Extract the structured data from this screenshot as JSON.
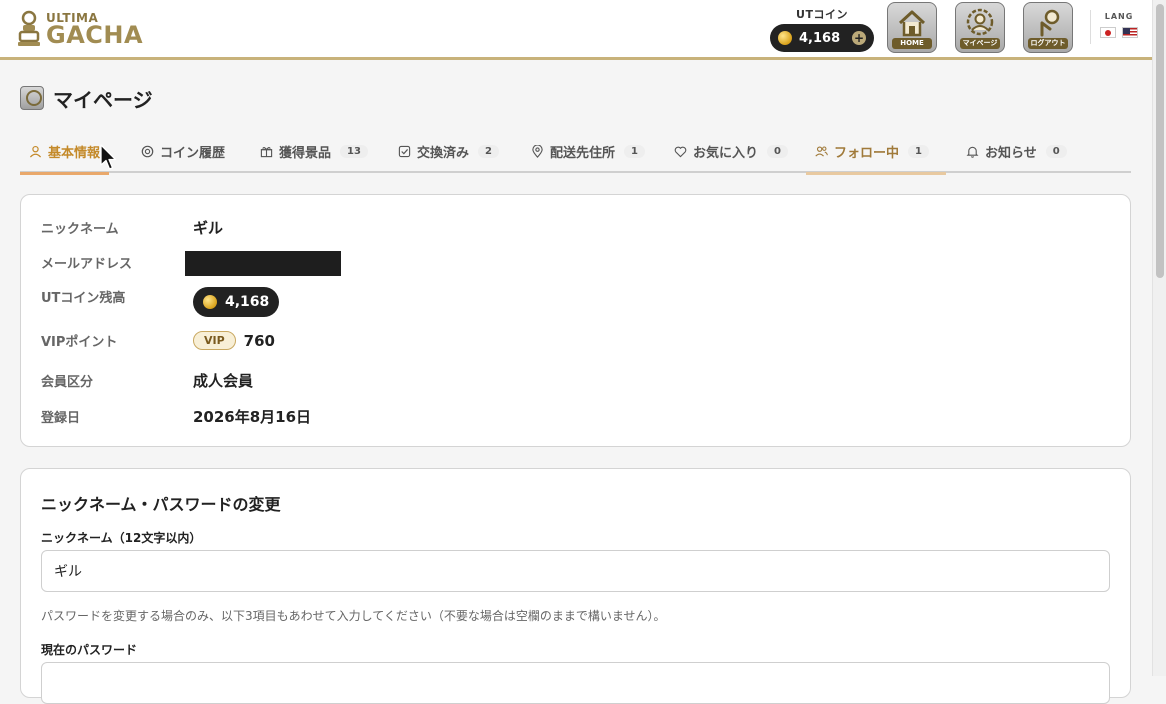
{
  "header": {
    "logo_small": "ULTIMA",
    "logo_big": "GACHA",
    "coin_label": "UTコイン",
    "coin_amount": "4,168",
    "nav": [
      {
        "label": "HOME",
        "icon": "home-icon"
      },
      {
        "label": "マイページ",
        "icon": "mypage-icon"
      },
      {
        "label": "ログアウト",
        "icon": "logout-icon"
      }
    ],
    "lang_label": "LANG"
  },
  "page": {
    "title": "マイページ"
  },
  "tabs": [
    {
      "label": "基本情報",
      "icon": "user-icon",
      "count": ""
    },
    {
      "label": "コイン履歴",
      "icon": "coin-icon",
      "count": ""
    },
    {
      "label": "獲得景品",
      "icon": "gift-icon",
      "count": "13"
    },
    {
      "label": "交換済み",
      "icon": "check-icon",
      "count": "2"
    },
    {
      "label": "配送先住所",
      "icon": "pin-icon",
      "count": "1"
    },
    {
      "label": "お気に入り",
      "icon": "heart-icon",
      "count": "0"
    },
    {
      "label": "フォロー中",
      "icon": "users-icon",
      "count": "1"
    },
    {
      "label": "お知らせ",
      "icon": "bell-icon",
      "count": "0"
    }
  ],
  "profile": {
    "nickname_label": "ニックネーム",
    "nickname": "ギル",
    "email_label": "メールアドレス",
    "balance_label": "UTコイン残高",
    "balance": "4,168",
    "vip_label": "VIPポイント",
    "vip_badge": "VIP",
    "vip_points": "760",
    "member_type_label": "会員区分",
    "member_type": "成人会員",
    "registered_label": "登録日",
    "registered": "2026年8月16日"
  },
  "form": {
    "title": "ニックネーム・パスワードの変更",
    "nickname_field_label": "ニックネーム（12文字以内）",
    "nickname_value": "ギル",
    "hint": "パスワードを変更する場合のみ、以下3項目もあわせて入力してください（不要な場合は空欄のままで構いません）。",
    "current_password_label": "現在のパスワード"
  },
  "colors": {
    "accent": "#c48a2a",
    "header_border": "#c8b27a",
    "dark_pill": "#222222"
  }
}
